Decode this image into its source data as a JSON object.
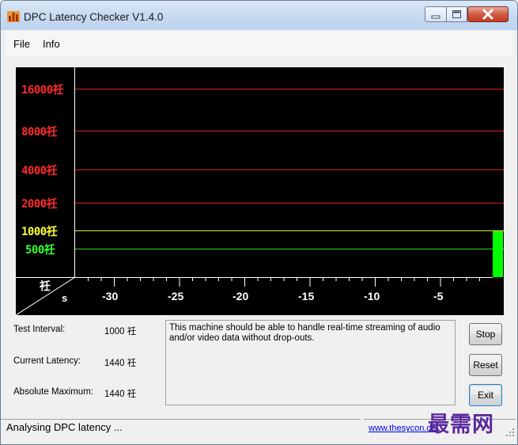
{
  "window": {
    "title": "DPC Latency Checker V1.4.0"
  },
  "menu": {
    "file": "File",
    "info": "Info"
  },
  "graph": {
    "y_labels": [
      {
        "text": "16000祍",
        "color": "#ff2a2a"
      },
      {
        "text": "8000祍",
        "color": "#ff2a2a"
      },
      {
        "text": "4000祍",
        "color": "#ff2a2a"
      },
      {
        "text": "2000祍",
        "color": "#ff2a2a"
      },
      {
        "text": "1000祍",
        "color": "#ffff33"
      },
      {
        "text": "500祍",
        "color": "#33ff33"
      }
    ],
    "corner_unit_y": "祍",
    "corner_unit_x": "s",
    "x_labels": [
      "-30",
      "-25",
      "-20",
      "-15",
      "-10",
      "-5"
    ],
    "bar_color": "#00ff00"
  },
  "info": {
    "test_interval_label": "Test Interval:",
    "test_interval_value": "1000 祍",
    "current_latency_label": "Current Latency:",
    "current_latency_value": "1440 祍",
    "absolute_maximum_label": "Absolute Maximum:",
    "absolute_maximum_value": "1440 祍"
  },
  "message": "This machine should be able to handle real-time streaming of audio and/or video data without drop-outs.",
  "buttons": {
    "stop": "Stop",
    "reset": "Reset",
    "exit": "Exit"
  },
  "status": {
    "text": "Analysing DPC latency ...",
    "link": "www.thesycon.de"
  },
  "watermark": "最需网"
}
